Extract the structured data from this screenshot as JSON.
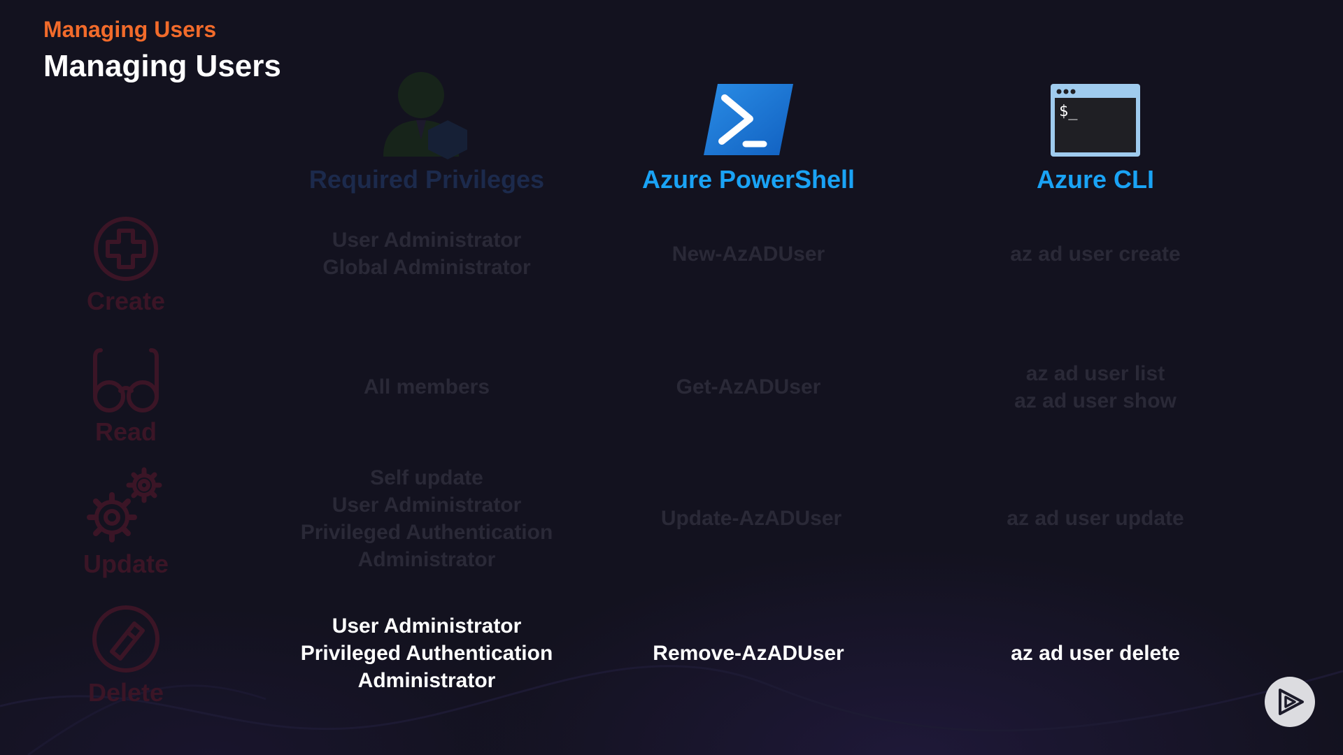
{
  "header": {
    "eyebrow": "Managing Users",
    "title": "Managing Users"
  },
  "columns": [
    {
      "label": "Required Privileges",
      "icon": "admin-user-icon",
      "state": "dimmed"
    },
    {
      "label": "Azure PowerShell",
      "icon": "powershell-icon",
      "state": "active"
    },
    {
      "label": "Azure CLI",
      "icon": "terminal-icon",
      "state": "active"
    }
  ],
  "rows": [
    {
      "label": "Create",
      "icon": "plus-circle-icon",
      "privileges": [
        "User Administrator",
        "Global Administrator"
      ],
      "powershell": "New-AzADUser",
      "cli": [
        "az ad user create"
      ],
      "state": "dimmed"
    },
    {
      "label": "Read",
      "icon": "glasses-icon",
      "privileges": [
        "All members"
      ],
      "powershell": "Get-AzADUser",
      "cli": [
        "az ad user list",
        "az ad user show"
      ],
      "state": "dimmed"
    },
    {
      "label": "Update",
      "icon": "gears-icon",
      "privileges": [
        "Self update",
        "User Administrator",
        "Privileged Authentication",
        "Administrator"
      ],
      "powershell": "Update-AzADUser",
      "cli": [
        "az ad user update"
      ],
      "state": "dimmed"
    },
    {
      "label": "Delete",
      "icon": "eraser-circle-icon",
      "privileges": [
        "User Administrator",
        "Privileged Authentication",
        "Administrator"
      ],
      "powershell": "Remove-AzADUser",
      "cli": [
        "az ad user delete"
      ],
      "state": "active"
    }
  ],
  "terminal_prompt": "$_",
  "player": {
    "icon": "play-icon"
  },
  "colors": {
    "background": "#13121f",
    "eyebrow": "#f26b2b",
    "title": "#ffffff",
    "column_active": "#1aa3f5",
    "column_dim": "#1c2a4c",
    "row_label_dim": "#3b1526",
    "cell_dim": "#2a2937",
    "cell_active": "#ffffff"
  }
}
